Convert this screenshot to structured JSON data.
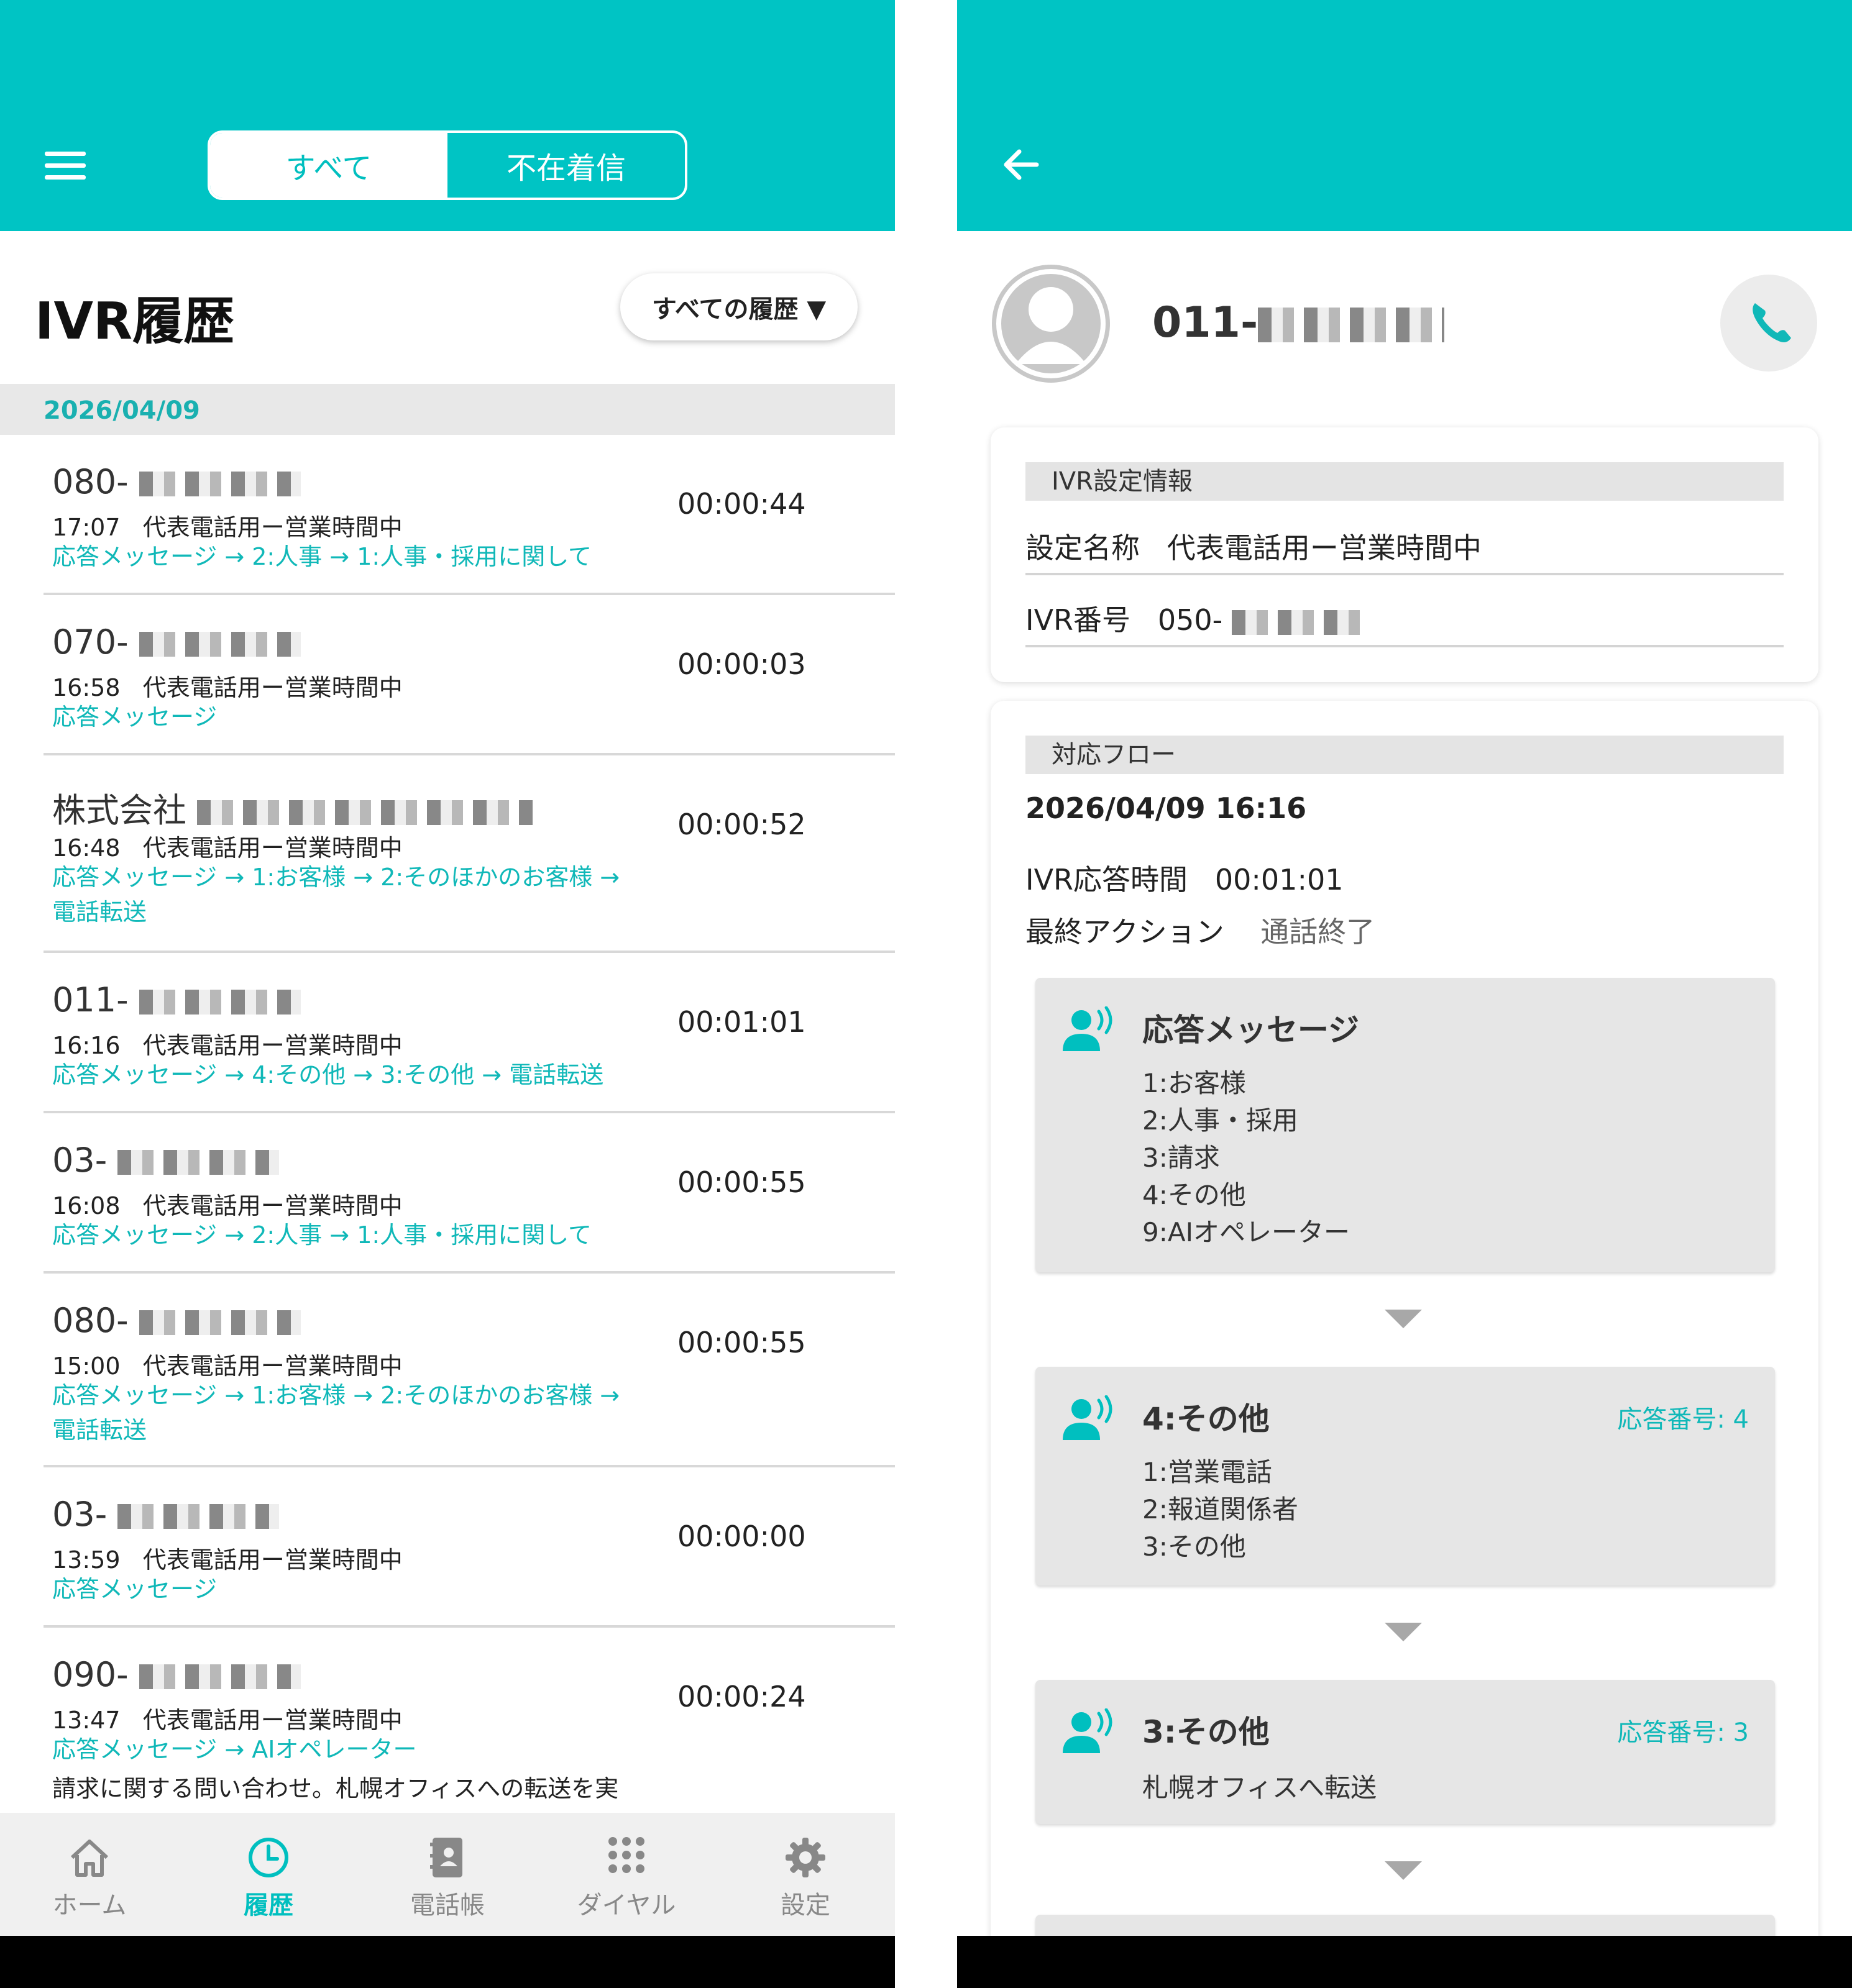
{
  "left": {
    "tabs": {
      "all": "すべて",
      "missed": "不在着信"
    },
    "title": "IVR履歴",
    "filter": "すべての履歴 ▼",
    "date_group": "2026/04/09",
    "rows": [
      {
        "prefix": "080-",
        "time": "17:07",
        "setting": "代表電話用ー営業時間中",
        "flow": "応答メッセージ → 2:人事 → 1:人事・採用に関して",
        "duration": "00:00:44"
      },
      {
        "prefix": "070-",
        "time": "16:58",
        "setting": "代表電話用ー営業時間中",
        "flow": "応答メッセージ",
        "duration": "00:00:03"
      },
      {
        "prefix": "株式会社",
        "time": "16:48",
        "setting": "代表電話用ー営業時間中",
        "flow": "応答メッセージ → 1:お客様 → 2:そのほかのお客様 → 電話転送",
        "duration": "00:00:52"
      },
      {
        "prefix": "011-",
        "time": "16:16",
        "setting": "代表電話用ー営業時間中",
        "flow": "応答メッセージ → 4:その他 → 3:その他 → 電話転送",
        "duration": "00:01:01"
      },
      {
        "prefix": "03-",
        "time": "16:08",
        "setting": "代表電話用ー営業時間中",
        "flow": "応答メッセージ → 2:人事 → 1:人事・採用に関して",
        "duration": "00:00:55"
      },
      {
        "prefix": "080-",
        "time": "15:00",
        "setting": "代表電話用ー営業時間中",
        "flow": "応答メッセージ → 1:お客様 → 2:そのほかのお客様 → 電話転送",
        "duration": "00:00:55"
      },
      {
        "prefix": "03-",
        "time": "13:59",
        "setting": "代表電話用ー営業時間中",
        "flow": "応答メッセージ",
        "duration": "00:00:00"
      },
      {
        "prefix": "090-",
        "time": "13:47",
        "setting": "代表電話用ー営業時間中",
        "flow": "応答メッセージ → AIオペレーター",
        "note": "請求に関する問い合わせ。札幌オフィスへの転送を実",
        "duration": "00:00:24"
      }
    ],
    "nav": [
      {
        "label": "ホーム",
        "icon": "home-icon"
      },
      {
        "label": "履歴",
        "icon": "history-clock-icon"
      },
      {
        "label": "電話帳",
        "icon": "phonebook-icon"
      },
      {
        "label": "ダイヤル",
        "icon": "dialpad-icon"
      },
      {
        "label": "設定",
        "icon": "gear-icon"
      }
    ],
    "active_nav": "履歴"
  },
  "right": {
    "caller_prefix": "011-",
    "ivr_section": "IVR設定情報",
    "setting_label": "設定名称",
    "setting_value": "代表電話用ー営業時間中",
    "ivr_number_label": "IVR番号",
    "ivr_number_prefix": "050-",
    "flow_section": "対応フロー",
    "flow_datetime": "2026/04/09 16:16",
    "response_time_label": "IVR応答時間",
    "response_time_value": "00:01:01",
    "final_action_label": "最終アクション",
    "final_action_value": "通話終了",
    "flow_boxes": [
      {
        "title": "応答メッセージ",
        "number": "",
        "lines": [
          "1:お客様",
          "2:人事・採用",
          "3:請求",
          "4:その他",
          "9:AIオペレーター"
        ]
      },
      {
        "title": "4:その他",
        "number": "応答番号: 4",
        "lines": [
          "1:営業電話",
          "2:報道関係者",
          "3:その他"
        ]
      },
      {
        "title": "3:その他",
        "number": "応答番号: 3",
        "lines": [
          "札幌オフィスへ転送"
        ]
      }
    ]
  },
  "colors": {
    "accent": "#00c4c4",
    "link": "#10b8b8"
  }
}
